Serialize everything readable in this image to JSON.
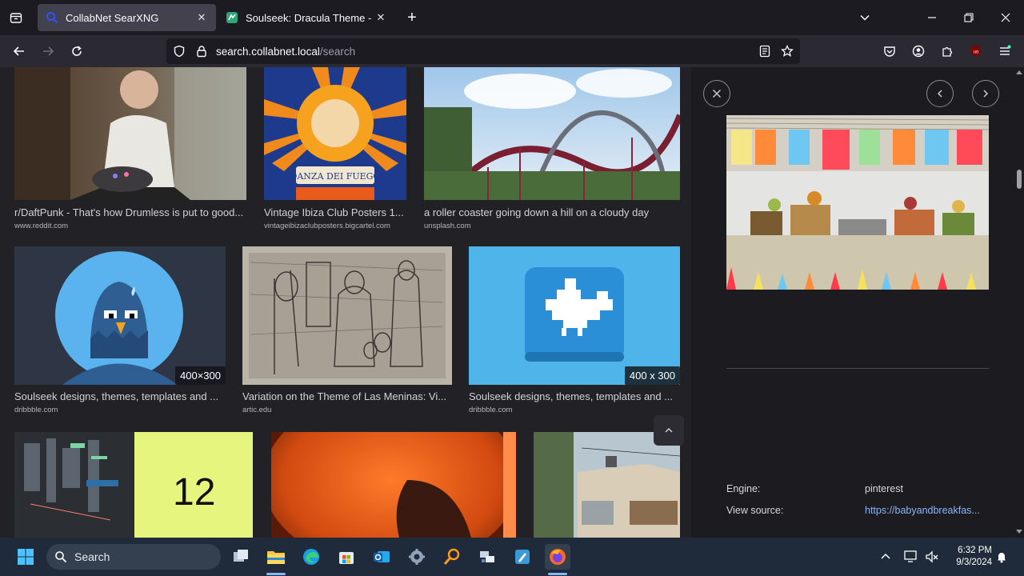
{
  "browser": {
    "tabs": [
      {
        "title": "CollabNet SearXNG",
        "active": true
      },
      {
        "title": "Soulseek: Dracula Theme - Img",
        "active": false
      }
    ],
    "new_tab": "+",
    "url_host": "search.collabnet.local",
    "url_path": "/search"
  },
  "results": [
    {
      "title": "r/DaftPunk - That's how Drumless is put to good...",
      "source": "www.reddit.com"
    },
    {
      "title": "Vintage Ibiza Club Posters 1...",
      "source": "vintageibizaclubposters.bigcartel.com",
      "poster_text": "DANZA DEI FUEGO"
    },
    {
      "title": "a roller coaster going down a hill on a cloudy day",
      "source": "unsplash.com"
    },
    {
      "title": "Soulseek designs, themes, templates and ...",
      "source": "dribbble.com",
      "dims": "400×300"
    },
    {
      "title": "Variation on the Theme of Las Meninas: Vi...",
      "source": "artic.edu"
    },
    {
      "title": "Soulseek designs, themes, templates and ...",
      "source": "dribbble.com",
      "dims": "400 x 300"
    },
    {
      "title": "",
      "source": "",
      "big_text": "12"
    },
    {
      "title": "",
      "source": ""
    },
    {
      "title": "",
      "source": ""
    }
  ],
  "detail": {
    "engine_label": "Engine:",
    "engine_value": "pinterest",
    "source_label": "View source:",
    "source_link": "https://babyandbreakfas..."
  },
  "taskbar": {
    "search_label": "Search",
    "time": "6:32 PM",
    "date": "9/3/2024"
  },
  "colors": {
    "accent_link": "#8ab4f8",
    "tab_active": "#42414d",
    "taskbar": "#1f2a3a"
  }
}
